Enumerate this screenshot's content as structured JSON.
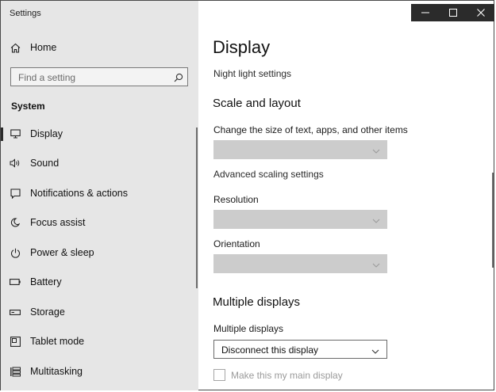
{
  "window": {
    "title": "Settings"
  },
  "caption": {
    "minimize": "—",
    "maximize": "☐",
    "close": "✕"
  },
  "sidebar": {
    "home_label": "Home",
    "search_placeholder": "Find a setting",
    "section": "System",
    "items": [
      {
        "label": "Display",
        "icon": "monitor-icon",
        "active": true
      },
      {
        "label": "Sound",
        "icon": "speaker-icon"
      },
      {
        "label": "Notifications & actions",
        "icon": "notification-icon"
      },
      {
        "label": "Focus assist",
        "icon": "moon-icon"
      },
      {
        "label": "Power & sleep",
        "icon": "power-icon"
      },
      {
        "label": "Battery",
        "icon": "battery-icon"
      },
      {
        "label": "Storage",
        "icon": "storage-icon"
      },
      {
        "label": "Tablet mode",
        "icon": "tablet-icon"
      },
      {
        "label": "Multitasking",
        "icon": "multitasking-icon"
      }
    ]
  },
  "main": {
    "title": "Display",
    "night_light_link": "Night light settings",
    "scale_heading": "Scale and layout",
    "scale_label": "Change the size of text, apps, and other items",
    "advanced_scaling_link": "Advanced scaling settings",
    "resolution_label": "Resolution",
    "orientation_label": "Orientation",
    "multiple_heading": "Multiple displays",
    "multiple_label": "Multiple displays",
    "multiple_value": "Disconnect this display",
    "main_display_checkbox": "Make this my main display"
  },
  "colors": {
    "sidebar_bg": "#e6e6e6",
    "disabled_combo": "#cccccc",
    "titlebar": "#2b2b2b"
  }
}
